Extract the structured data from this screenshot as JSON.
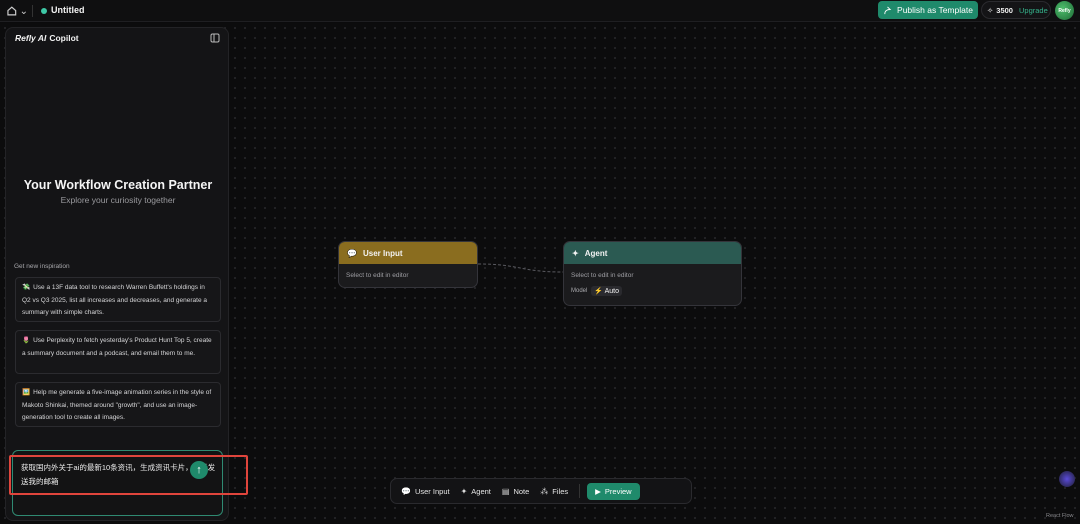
{
  "header": {
    "home_chevron": "⌄",
    "doc_title": "Untitled",
    "publish_label": "Publish as Template",
    "credits": "3500",
    "upgrade_label": "Upgrade",
    "avatar_text": "Refly"
  },
  "copilot": {
    "brand": "Refly AI",
    "title": "Copilot",
    "hero_title": "Your Workflow Creation Partner",
    "hero_subtitle": "Explore your curiosity together",
    "inspiration_label": "Get new inspiration",
    "cards": [
      {
        "emoji": "💸",
        "text": "Use a 13F data tool to research Warren Buffett's holdings in Q2 vs Q3 2025, list all increases and decreases, and generate a summary with simple charts."
      },
      {
        "emoji": "🌷",
        "text": "Use Perplexity to fetch yesterday's Product Hunt Top 5, create a summary document and a podcast, and email them to me."
      },
      {
        "emoji": "🖼️",
        "text": "Help me generate a five-image animation series in the style of Makoto Shinkai, themed around \"growth\", and use an image-generation tool to create all images."
      }
    ],
    "chat_input_value": "获取国内外关于ai的最新10条资讯，生成资讯卡片，然后发送我的邮箱"
  },
  "nodes": {
    "user_input": {
      "title": "User Input",
      "body": "Select to edit in editor"
    },
    "agent": {
      "title": "Agent",
      "body": "Select to edit in editor",
      "model_label": "Model",
      "model_value": "Auto"
    }
  },
  "toolbar": {
    "user_input": "User Input",
    "agent": "Agent",
    "note": "Note",
    "files": "Files",
    "preview": "Preview"
  },
  "footer": {
    "react_flow": "React Flow"
  },
  "colors": {
    "accent": "#1f8a6b",
    "user_input_header": "#8a6d1f",
    "agent_header": "#2b5a52",
    "highlight": "#e0453c"
  }
}
